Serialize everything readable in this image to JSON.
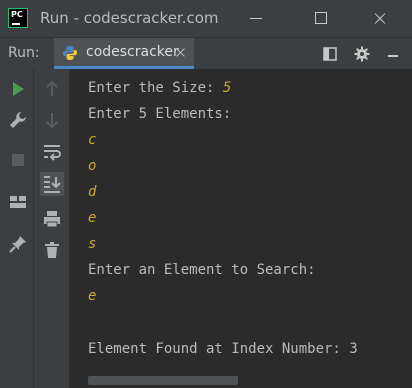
{
  "window": {
    "title": "Run - codescracker.com"
  },
  "runbar": {
    "label": "Run:",
    "tab_label": "codescracker"
  },
  "console": {
    "lines": [
      {
        "prompt": "Enter the Size: ",
        "input": "5"
      },
      {
        "prompt": "Enter 5 Elements:",
        "input": ""
      },
      {
        "prompt": "",
        "input": "c"
      },
      {
        "prompt": "",
        "input": "o"
      },
      {
        "prompt": "",
        "input": "d"
      },
      {
        "prompt": "",
        "input": "e"
      },
      {
        "prompt": "",
        "input": "s"
      },
      {
        "prompt": "Enter an Element to Search:",
        "input": ""
      },
      {
        "prompt": "",
        "input": "e"
      },
      {
        "prompt": "",
        "input": ""
      },
      {
        "prompt": "Element Found at Index Number: 3",
        "input": ""
      }
    ]
  },
  "colors": {
    "input_text": "#c9a92f",
    "output_text": "#bbbbbb",
    "accent": "#4a88c7",
    "run_green": "#499c54"
  },
  "icons": {
    "app": "pycharm-app-icon",
    "tab": "python-icon",
    "runbar": [
      "layout-icon",
      "gear-icon",
      "minimize-panel-icon"
    ],
    "strip1": [
      "run-icon",
      "wrench-icon",
      "stop-icon",
      "layout-icon",
      "pin-icon"
    ],
    "strip2": [
      "up-arrow-icon",
      "down-arrow-icon",
      "soft-wrap-icon",
      "scroll-to-end-icon",
      "print-icon",
      "trash-icon"
    ]
  }
}
